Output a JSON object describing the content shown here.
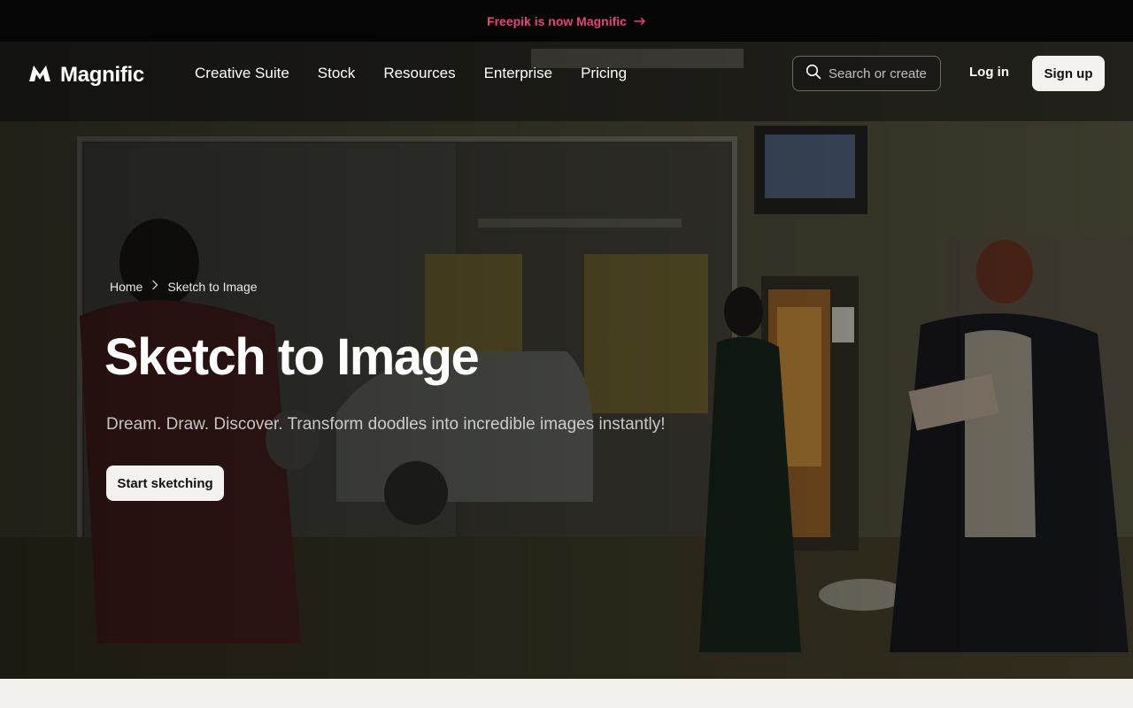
{
  "announcement": {
    "text": "Freepik is now Magnific",
    "arrow_icon": "arrow-right-icon"
  },
  "nav": {
    "brand": "Magnific",
    "logo_icon": "magnific-logo-icon",
    "menu": [
      {
        "label": "Creative Suite"
      },
      {
        "label": "Stock"
      },
      {
        "label": "Resources"
      },
      {
        "label": "Enterprise"
      },
      {
        "label": "Pricing"
      }
    ],
    "search": {
      "placeholder": "Search or create",
      "value": "",
      "icon": "search-icon"
    },
    "login_label": "Log in",
    "signup_label": "Sign up"
  },
  "breadcrumb": [
    {
      "label": "Home"
    },
    {
      "label": "Sketch to Image"
    }
  ],
  "hero": {
    "title": "Sketch to Image",
    "subtitle": "Dream. Draw. Discover. Transform doodles into incredible images instantly!",
    "cta_label": "Start sketching"
  },
  "colors": {
    "announcement_text": "#e8437e",
    "announcement_bg": "#050505",
    "button_bg": "#f3f2ee",
    "page_bg": "#f1f0ec"
  }
}
